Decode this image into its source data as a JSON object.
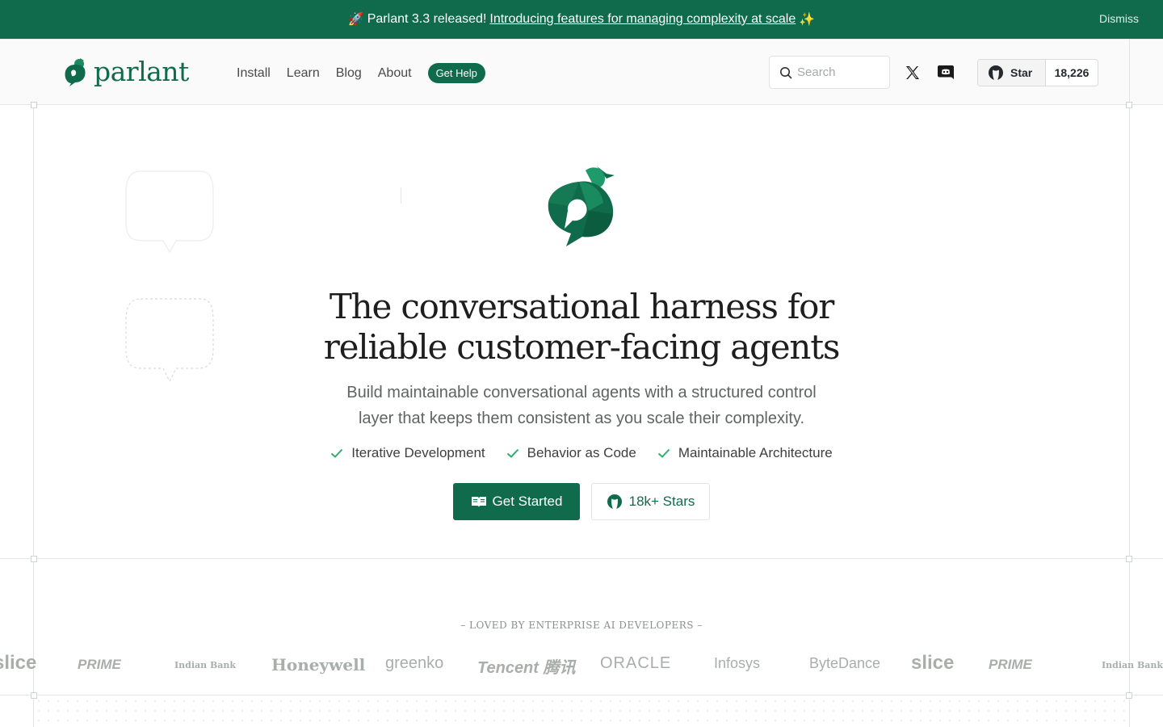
{
  "announcement": {
    "prefix": "Parlant 3.3 released!",
    "link": "Introducing features for managing complexity at scale",
    "dismiss": "Dismiss",
    "rocket_icon": "rocket-icon",
    "sparkle_icon": "sparkles-icon"
  },
  "header": {
    "logo_text": "parlant",
    "nav": [
      "Install",
      "Learn",
      "Blog",
      "About"
    ],
    "help": "Get Help",
    "search_placeholder": "Search",
    "github": {
      "label": "Star",
      "count": "18,226"
    }
  },
  "hero": {
    "title_line1": "The conversational harness for",
    "title_line2": "reliable customer-facing agents",
    "subtitle_line1": "Build maintainable conversational agents with a structured control",
    "subtitle_line2": "layer that keeps them consistent as you scale their complexity.",
    "features": [
      "Iterative Development",
      "Behavior as Code",
      "Maintainable Architecture"
    ],
    "primary_button": "Get Started",
    "secondary_button": "18k+ Stars"
  },
  "logos": {
    "heading": "– LOVED BY ENTERPRISE AI DEVELOPERS –",
    "companies": [
      "slice",
      "PRIME",
      "Indian Bank",
      "Honeywell",
      "greenko",
      "Tencent 腾讯",
      "ORACLE",
      "Infosys",
      "ByteDance",
      "slice",
      "PRIME",
      "Indian Bank"
    ]
  },
  "colors": {
    "brand": "#0f6b4b",
    "check": "#2fae6e"
  }
}
